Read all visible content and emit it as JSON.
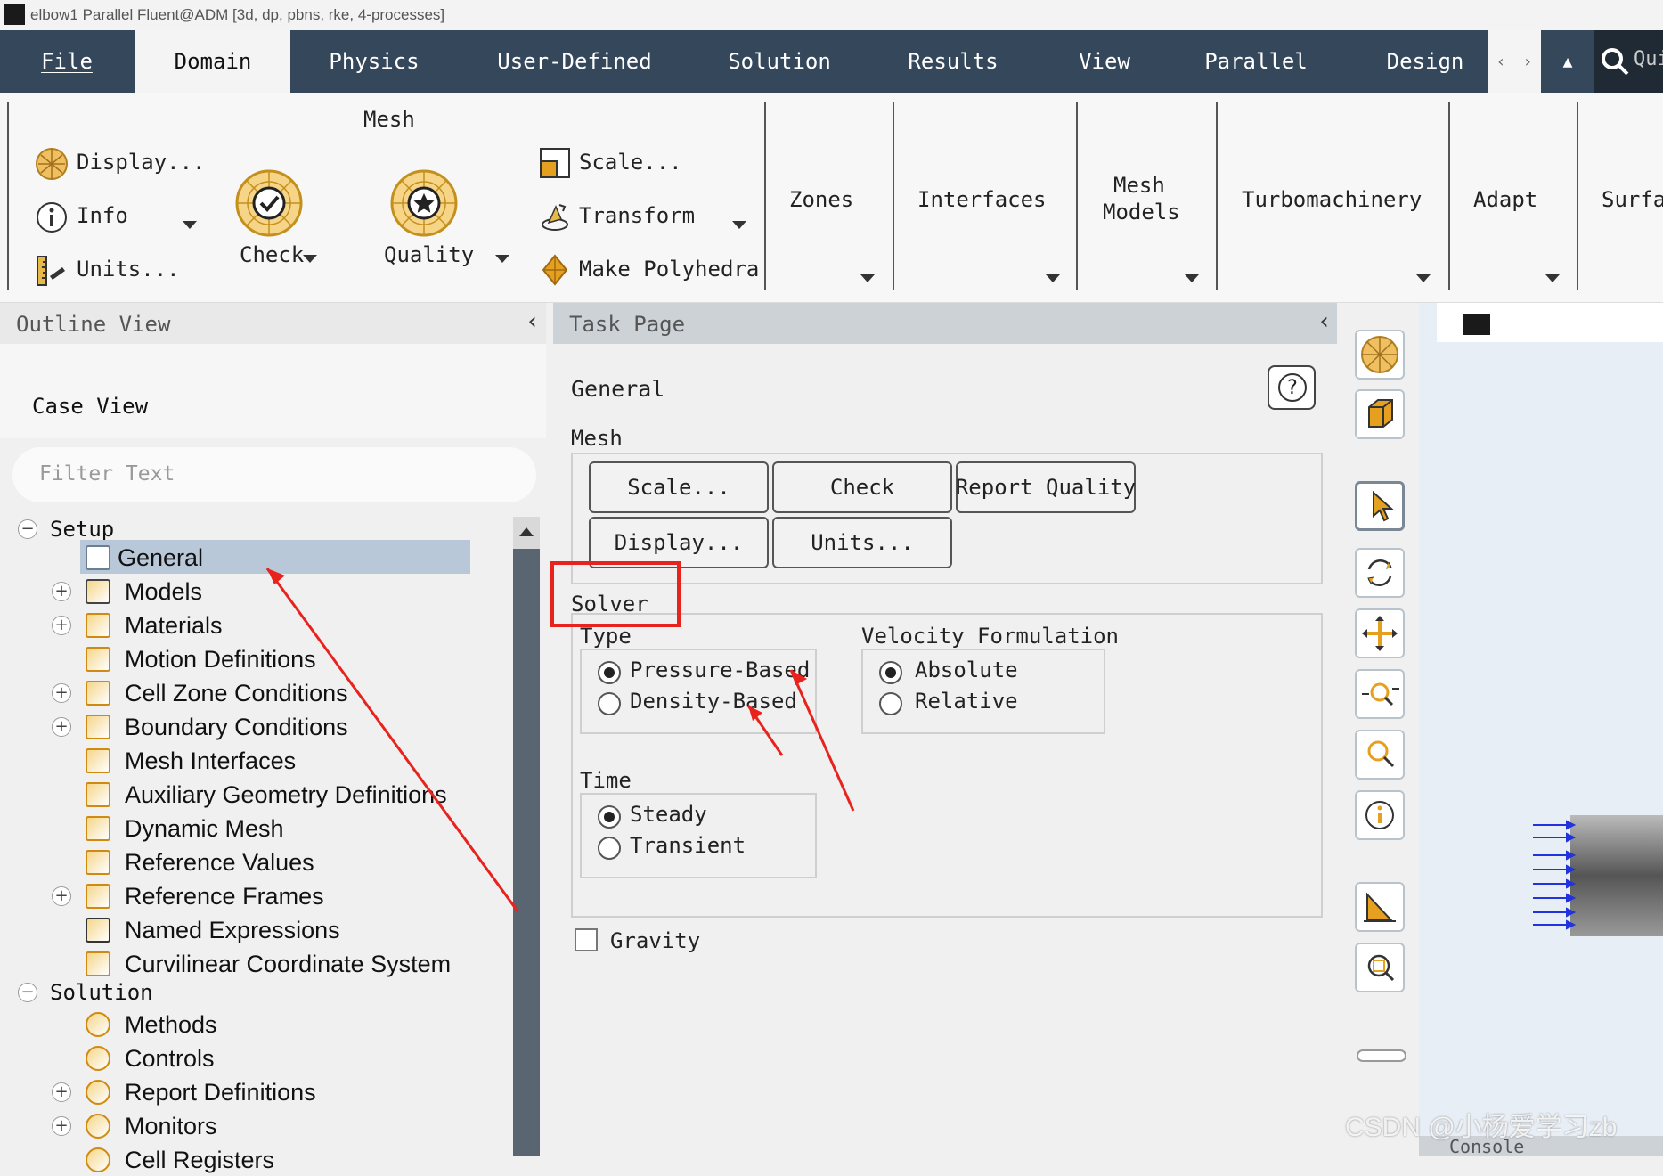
{
  "window": {
    "title": "elbow1 Parallel Fluent@ADM  [3d, dp, pbns, rke, 4-processes]"
  },
  "menu": {
    "tabs": [
      "File",
      "Domain",
      "Physics",
      "User-Defined",
      "Solution",
      "Results",
      "View",
      "Parallel",
      "Design"
    ],
    "nav_left": "‹",
    "nav_right": "›",
    "collapse": "▲",
    "quick_search": "Qui"
  },
  "ribbon": {
    "mesh_group": "Mesh",
    "display": "Display...",
    "info": "Info",
    "units": "Units...",
    "check": "Check",
    "quality": "Quality",
    "scale": "Scale...",
    "transform": "Transform",
    "make_polyhedra": "Make Polyhedra",
    "zones": "Zones",
    "interfaces": "Interfaces",
    "mesh_models_1": "Mesh",
    "mesh_models_2": "Models",
    "turbomachinery": "Turbomachinery",
    "adapt": "Adapt",
    "surface": "Surfac"
  },
  "outline": {
    "title": "Outline View",
    "collapse": "‹",
    "case_view": "Case View",
    "filter_placeholder": "Filter Text",
    "setup": "Setup",
    "setup_items": [
      "General",
      "Models",
      "Materials",
      "Motion Definitions",
      "Cell Zone Conditions",
      "Boundary Conditions",
      "Mesh Interfaces",
      "Auxiliary Geometry Definitions",
      "Dynamic Mesh",
      "Reference Values",
      "Reference Frames",
      "Named Expressions",
      "Curvilinear Coordinate System"
    ],
    "solution": "Solution",
    "solution_items": [
      "Methods",
      "Controls",
      "Report Definitions",
      "Monitors",
      "Cell Registers"
    ]
  },
  "task": {
    "title": "Task Page",
    "collapse": "‹",
    "heading": "General",
    "help": "?",
    "mesh_label": "Mesh",
    "btn_scale": "Scale...",
    "btn_check": "Check",
    "btn_report_quality": "Report Quality",
    "btn_display": "Display...",
    "btn_units": "Units...",
    "solver_label": "Solver",
    "type_label": "Type",
    "pressure_based": "Pressure-Based",
    "density_based": "Density-Based",
    "velocity_label": "Velocity Formulation",
    "absolute": "Absolute",
    "relative": "Relative",
    "time_label": "Time",
    "steady": "Steady",
    "transient": "Transient",
    "gravity": "Gravity"
  },
  "console": {
    "label": "Console"
  },
  "watermark": "CSDN @小杨爱学习zb",
  "colors": {
    "menubar": "#35485b",
    "selected": "#b8c8d8",
    "annotation": "#e8231d"
  }
}
